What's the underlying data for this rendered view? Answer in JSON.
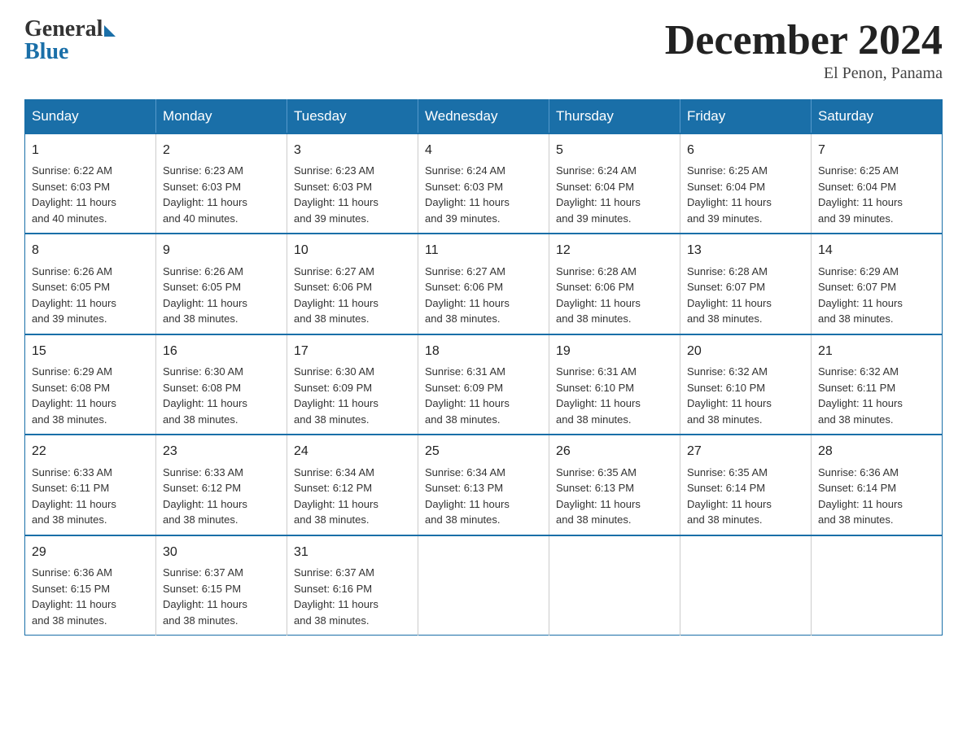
{
  "header": {
    "logo_general": "General",
    "logo_blue": "Blue",
    "title": "December 2024",
    "location": "El Penon, Panama"
  },
  "weekdays": [
    "Sunday",
    "Monday",
    "Tuesday",
    "Wednesday",
    "Thursday",
    "Friday",
    "Saturday"
  ],
  "weeks": [
    [
      {
        "day": "1",
        "sunrise": "6:22 AM",
        "sunset": "6:03 PM",
        "daylight": "11 hours and 40 minutes."
      },
      {
        "day": "2",
        "sunrise": "6:23 AM",
        "sunset": "6:03 PM",
        "daylight": "11 hours and 40 minutes."
      },
      {
        "day": "3",
        "sunrise": "6:23 AM",
        "sunset": "6:03 PM",
        "daylight": "11 hours and 39 minutes."
      },
      {
        "day": "4",
        "sunrise": "6:24 AM",
        "sunset": "6:03 PM",
        "daylight": "11 hours and 39 minutes."
      },
      {
        "day": "5",
        "sunrise": "6:24 AM",
        "sunset": "6:04 PM",
        "daylight": "11 hours and 39 minutes."
      },
      {
        "day": "6",
        "sunrise": "6:25 AM",
        "sunset": "6:04 PM",
        "daylight": "11 hours and 39 minutes."
      },
      {
        "day": "7",
        "sunrise": "6:25 AM",
        "sunset": "6:04 PM",
        "daylight": "11 hours and 39 minutes."
      }
    ],
    [
      {
        "day": "8",
        "sunrise": "6:26 AM",
        "sunset": "6:05 PM",
        "daylight": "11 hours and 39 minutes."
      },
      {
        "day": "9",
        "sunrise": "6:26 AM",
        "sunset": "6:05 PM",
        "daylight": "11 hours and 38 minutes."
      },
      {
        "day": "10",
        "sunrise": "6:27 AM",
        "sunset": "6:06 PM",
        "daylight": "11 hours and 38 minutes."
      },
      {
        "day": "11",
        "sunrise": "6:27 AM",
        "sunset": "6:06 PM",
        "daylight": "11 hours and 38 minutes."
      },
      {
        "day": "12",
        "sunrise": "6:28 AM",
        "sunset": "6:06 PM",
        "daylight": "11 hours and 38 minutes."
      },
      {
        "day": "13",
        "sunrise": "6:28 AM",
        "sunset": "6:07 PM",
        "daylight": "11 hours and 38 minutes."
      },
      {
        "day": "14",
        "sunrise": "6:29 AM",
        "sunset": "6:07 PM",
        "daylight": "11 hours and 38 minutes."
      }
    ],
    [
      {
        "day": "15",
        "sunrise": "6:29 AM",
        "sunset": "6:08 PM",
        "daylight": "11 hours and 38 minutes."
      },
      {
        "day": "16",
        "sunrise": "6:30 AM",
        "sunset": "6:08 PM",
        "daylight": "11 hours and 38 minutes."
      },
      {
        "day": "17",
        "sunrise": "6:30 AM",
        "sunset": "6:09 PM",
        "daylight": "11 hours and 38 minutes."
      },
      {
        "day": "18",
        "sunrise": "6:31 AM",
        "sunset": "6:09 PM",
        "daylight": "11 hours and 38 minutes."
      },
      {
        "day": "19",
        "sunrise": "6:31 AM",
        "sunset": "6:10 PM",
        "daylight": "11 hours and 38 minutes."
      },
      {
        "day": "20",
        "sunrise": "6:32 AM",
        "sunset": "6:10 PM",
        "daylight": "11 hours and 38 minutes."
      },
      {
        "day": "21",
        "sunrise": "6:32 AM",
        "sunset": "6:11 PM",
        "daylight": "11 hours and 38 minutes."
      }
    ],
    [
      {
        "day": "22",
        "sunrise": "6:33 AM",
        "sunset": "6:11 PM",
        "daylight": "11 hours and 38 minutes."
      },
      {
        "day": "23",
        "sunrise": "6:33 AM",
        "sunset": "6:12 PM",
        "daylight": "11 hours and 38 minutes."
      },
      {
        "day": "24",
        "sunrise": "6:34 AM",
        "sunset": "6:12 PM",
        "daylight": "11 hours and 38 minutes."
      },
      {
        "day": "25",
        "sunrise": "6:34 AM",
        "sunset": "6:13 PM",
        "daylight": "11 hours and 38 minutes."
      },
      {
        "day": "26",
        "sunrise": "6:35 AM",
        "sunset": "6:13 PM",
        "daylight": "11 hours and 38 minutes."
      },
      {
        "day": "27",
        "sunrise": "6:35 AM",
        "sunset": "6:14 PM",
        "daylight": "11 hours and 38 minutes."
      },
      {
        "day": "28",
        "sunrise": "6:36 AM",
        "sunset": "6:14 PM",
        "daylight": "11 hours and 38 minutes."
      }
    ],
    [
      {
        "day": "29",
        "sunrise": "6:36 AM",
        "sunset": "6:15 PM",
        "daylight": "11 hours and 38 minutes."
      },
      {
        "day": "30",
        "sunrise": "6:37 AM",
        "sunset": "6:15 PM",
        "daylight": "11 hours and 38 minutes."
      },
      {
        "day": "31",
        "sunrise": "6:37 AM",
        "sunset": "6:16 PM",
        "daylight": "11 hours and 38 minutes."
      },
      null,
      null,
      null,
      null
    ]
  ],
  "labels": {
    "sunrise": "Sunrise:",
    "sunset": "Sunset:",
    "daylight": "Daylight:"
  }
}
